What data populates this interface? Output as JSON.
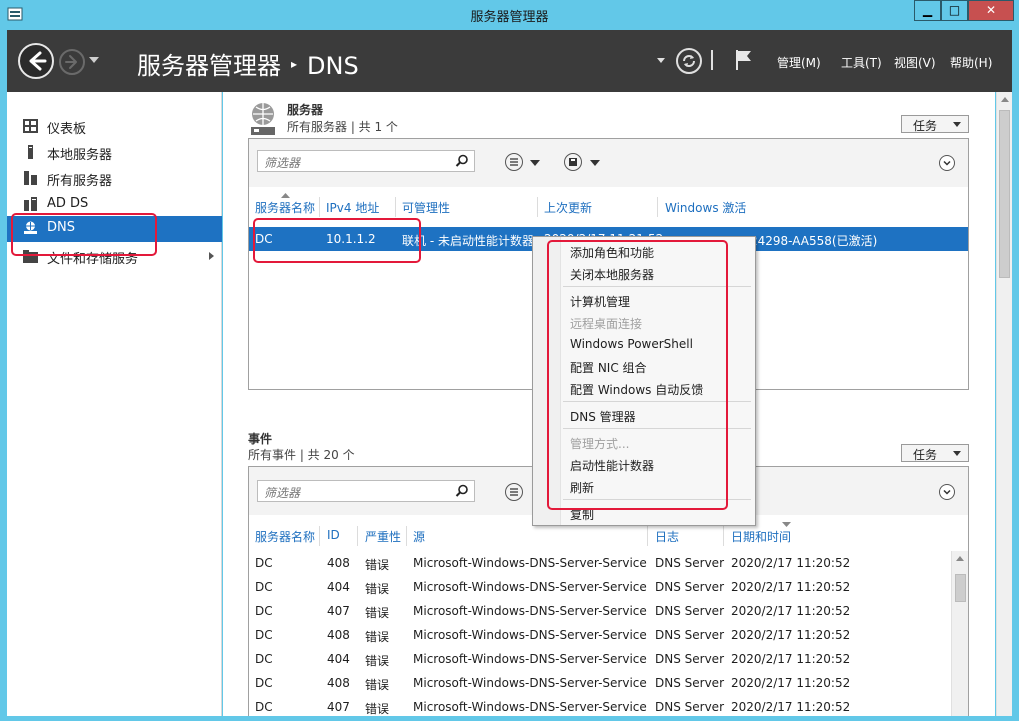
{
  "window": {
    "title": "服务器管理器",
    "min": "▁",
    "max": "□",
    "close": "✕"
  },
  "header": {
    "breadcrumb_root": "服务器管理器",
    "breadcrumb_sep": "▸",
    "breadcrumb_current": "DNS",
    "pipe": "|",
    "menus": [
      "管理(M)",
      "工具(T)",
      "视图(V)",
      "帮助(H)"
    ]
  },
  "sidebar": {
    "items": [
      {
        "label": "仪表板",
        "icon": "dashboard-icon"
      },
      {
        "label": "本地服务器",
        "icon": "server-icon"
      },
      {
        "label": "所有服务器",
        "icon": "servers-icon"
      },
      {
        "label": "AD DS",
        "icon": "adds-icon"
      },
      {
        "label": "DNS",
        "icon": "dns-icon",
        "active": true
      },
      {
        "label": "文件和存储服务",
        "icon": "file-storage-icon",
        "has_children": true
      }
    ]
  },
  "servers_section": {
    "title": "服务器",
    "subtitle": "所有服务器 | 共 1 个",
    "tasks": "任务",
    "filter_placeholder": "筛选器",
    "columns": [
      "服务器名称",
      "IPv4 地址",
      "可管理性",
      "上次更新",
      "Windows 激活"
    ],
    "row": {
      "name": "DC",
      "ip": "10.1.1.2",
      "manageability": "联机 - 未启动性能计数器",
      "last_update": "2020/2/17 11:21:52",
      "activation": "00252-60070-24298-AA558(已激活)"
    }
  },
  "events_section": {
    "title": "事件",
    "subtitle": "所有事件 | 共 20 个",
    "tasks": "任务",
    "filter_placeholder": "筛选器",
    "columns": [
      "服务器名称",
      "ID",
      "严重性",
      "源",
      "日志",
      "日期和时间"
    ],
    "rows": [
      {
        "server": "DC",
        "id": "408",
        "severity": "错误",
        "source": "Microsoft-Windows-DNS-Server-Service",
        "log": "DNS Server",
        "time": "2020/2/17 11:20:52"
      },
      {
        "server": "DC",
        "id": "404",
        "severity": "错误",
        "source": "Microsoft-Windows-DNS-Server-Service",
        "log": "DNS Server",
        "time": "2020/2/17 11:20:52"
      },
      {
        "server": "DC",
        "id": "407",
        "severity": "错误",
        "source": "Microsoft-Windows-DNS-Server-Service",
        "log": "DNS Server",
        "time": "2020/2/17 11:20:52"
      },
      {
        "server": "DC",
        "id": "408",
        "severity": "错误",
        "source": "Microsoft-Windows-DNS-Server-Service",
        "log": "DNS Server",
        "time": "2020/2/17 11:20:52"
      },
      {
        "server": "DC",
        "id": "404",
        "severity": "错误",
        "source": "Microsoft-Windows-DNS-Server-Service",
        "log": "DNS Server",
        "time": "2020/2/17 11:20:52"
      },
      {
        "server": "DC",
        "id": "408",
        "severity": "错误",
        "source": "Microsoft-Windows-DNS-Server-Service",
        "log": "DNS Server",
        "time": "2020/2/17 11:20:52"
      },
      {
        "server": "DC",
        "id": "407",
        "severity": "错误",
        "source": "Microsoft-Windows-DNS-Server-Service",
        "log": "DNS Server",
        "time": "2020/2/17 11:20:52"
      }
    ]
  },
  "context_menu": {
    "items": [
      {
        "label": "添加角色和功能"
      },
      {
        "label": "关闭本地服务器"
      },
      {
        "label": "计算机管理"
      },
      {
        "label": "远程桌面连接",
        "disabled": true
      },
      {
        "label": "Windows PowerShell"
      },
      {
        "label": "配置 NIC 组合"
      },
      {
        "label": "配置 Windows 自动反馈"
      },
      {
        "label": "DNS 管理器"
      },
      {
        "label": "管理方式...",
        "disabled": true
      },
      {
        "label": "启动性能计数器"
      },
      {
        "label": "刷新"
      },
      {
        "label": "复制"
      }
    ]
  },
  "colors": {
    "titlebar": "#62c8e8",
    "header": "#3b3b3b",
    "selection": "#1e72c2",
    "highlight": "#e3193a",
    "column_text": "#1e6fbf"
  }
}
